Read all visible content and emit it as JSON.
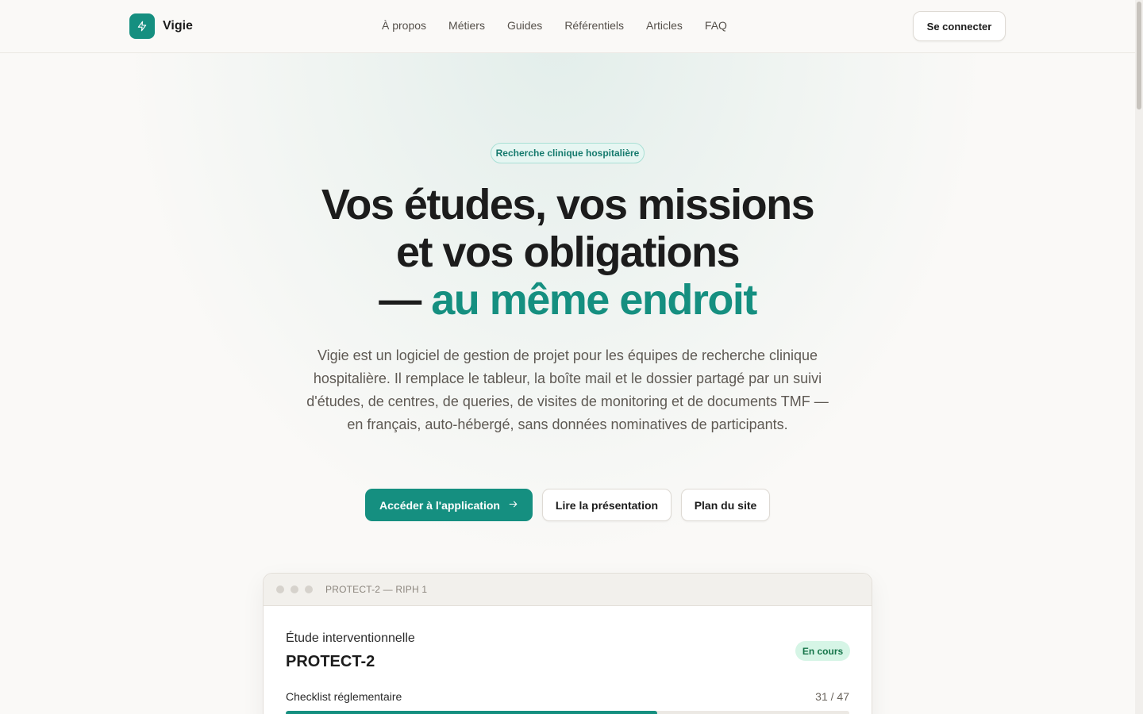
{
  "header": {
    "brand": "Vigie",
    "nav": [
      "À propos",
      "Métiers",
      "Guides",
      "Référentiels",
      "Articles",
      "FAQ"
    ],
    "login_label": "Se connecter"
  },
  "hero": {
    "badge": "Recherche clinique hospitalière",
    "title_line1": "Vos études, vos missions",
    "title_line2": "et vos obligations",
    "title_dash": "— ",
    "title_accent": "au même endroit",
    "description": "Vigie est un logiciel de gestion de projet pour les équipes de recherche clinique hospitalière. Il remplace le tableur, la boîte mail et le dossier partagé par un suivi d'études, de centres, de queries, de visites de monitoring et de documents TMF — en français, auto-hébergé, sans données nominatives de participants.",
    "cta_primary": "Accéder à l'application",
    "cta_read": "Lire la présentation",
    "cta_plan": "Plan du site"
  },
  "preview": {
    "window_title": "PROTECT-2 — RIPH 1",
    "study_type": "Étude interventionnelle",
    "study_name": "PROTECT-2",
    "status": "En cours",
    "checklist_label": "Checklist réglementaire",
    "checklist_done": 31,
    "checklist_total": 47,
    "checklist_count": "31 / 47"
  },
  "colors": {
    "accent": "#158f80",
    "background": "#faf9f7",
    "status_bg": "#d6f5e6"
  },
  "icons": {
    "logo": "lightning-bolt-icon",
    "cta_arrow": "arrow-right-icon"
  }
}
